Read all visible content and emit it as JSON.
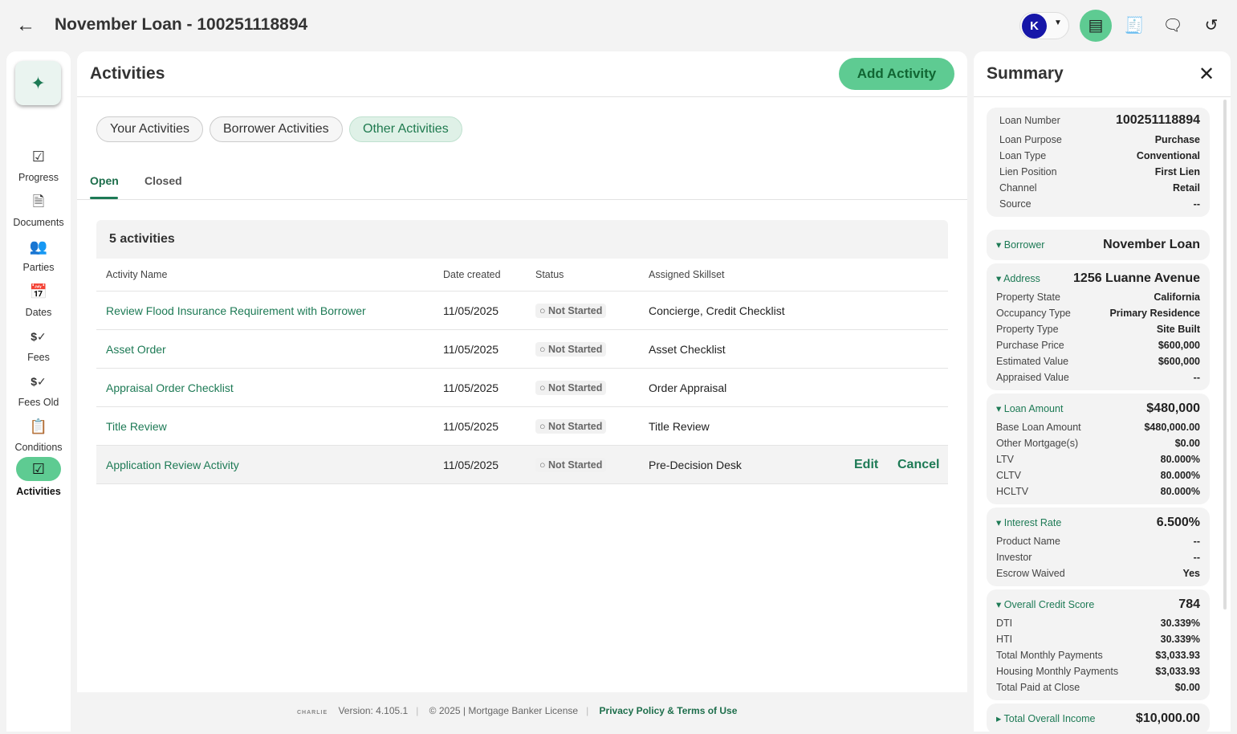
{
  "header": {
    "title": "November Loan - 100251118894",
    "avatar_initial": "K"
  },
  "sidebar": {
    "items": [
      {
        "label": "Progress",
        "icon": "☑"
      },
      {
        "label": "Documents",
        "icon": "🗎"
      },
      {
        "label": "Parties",
        "icon": "👥"
      },
      {
        "label": "Dates",
        "icon": "📅"
      },
      {
        "label": "Fees",
        "icon": "$✓"
      },
      {
        "label": "Fees Old",
        "icon": "$✓"
      },
      {
        "label": "Conditions",
        "icon": "📋"
      },
      {
        "label": "Activities",
        "icon": "☑"
      }
    ]
  },
  "main": {
    "title": "Activities",
    "add_label": "Add Activity",
    "chips": [
      "Your Activities",
      "Borrower Activities",
      "Other Activities"
    ],
    "tabs": [
      "Open",
      "Closed"
    ],
    "count": "5 activities",
    "columns": [
      "Activity Name",
      "Date created",
      "Status",
      "Assigned Skillset"
    ],
    "rows": [
      {
        "name": "Review Flood Insurance Requirement with Borrower",
        "date": "11/05/2025",
        "status": "Not Started",
        "skillset": "Concierge, Credit Checklist"
      },
      {
        "name": "Asset Order",
        "date": "11/05/2025",
        "status": "Not Started",
        "skillset": "Asset Checklist"
      },
      {
        "name": "Appraisal Order Checklist",
        "date": "11/05/2025",
        "status": "Not Started",
        "skillset": "Order Appraisal"
      },
      {
        "name": "Title Review",
        "date": "11/05/2025",
        "status": "Not Started",
        "skillset": "Title Review"
      },
      {
        "name": "Application Review Activity",
        "date": "11/05/2025",
        "status": "Not Started",
        "skillset": "Pre-Decision Desk"
      }
    ],
    "edit_label": "Edit",
    "cancel_label": "Cancel"
  },
  "footer": {
    "logo": "CHARLIE",
    "version": "Version: 4.105.1",
    "copyright": "© 2025 | Mortgage Banker License",
    "link": "Privacy Policy & Terms of Use"
  },
  "summary": {
    "title": "Summary",
    "loan": [
      [
        "Loan Number",
        "100251118894"
      ],
      [
        "Loan Purpose",
        "Purchase"
      ],
      [
        "Loan Type",
        "Conventional"
      ],
      [
        "Lien Position",
        "First Lien"
      ],
      [
        "Channel",
        "Retail"
      ],
      [
        "Source",
        "--"
      ]
    ],
    "borrower": [
      "Borrower",
      "November Loan"
    ],
    "address": {
      "head": [
        "Address",
        "1256 Luanne Avenue"
      ],
      "rows": [
        [
          "Property State",
          "California"
        ],
        [
          "Occupancy Type",
          "Primary Residence"
        ],
        [
          "Property Type",
          "Site Built"
        ],
        [
          "Purchase Price",
          "$600,000"
        ],
        [
          "Estimated Value",
          "$600,000"
        ],
        [
          "Appraised Value",
          "--"
        ]
      ]
    },
    "loan_amount": {
      "head": [
        "Loan Amount",
        "$480,000"
      ],
      "rows": [
        [
          "Base Loan Amount",
          "$480,000.00"
        ],
        [
          "Other Mortgage(s)",
          "$0.00"
        ],
        [
          "LTV",
          "80.000%"
        ],
        [
          "CLTV",
          "80.000%"
        ],
        [
          "HCLTV",
          "80.000%"
        ]
      ]
    },
    "interest": {
      "head": [
        "Interest Rate",
        "6.500%"
      ],
      "rows": [
        [
          "Product Name",
          "--"
        ],
        [
          "Investor",
          "--"
        ],
        [
          "Escrow Waived",
          "Yes"
        ]
      ]
    },
    "credit": {
      "head": [
        "Overall Credit Score",
        "784"
      ],
      "rows": [
        [
          "DTI",
          "30.339%"
        ],
        [
          "HTI",
          "30.339%"
        ],
        [
          "Total Monthly Payments",
          "$3,033.93"
        ],
        [
          "Housing Monthly Payments",
          "$3,033.93"
        ],
        [
          "Total Paid at Close",
          "$0.00"
        ]
      ]
    },
    "income": [
      "Total Overall Income",
      "$10,000.00"
    ]
  }
}
